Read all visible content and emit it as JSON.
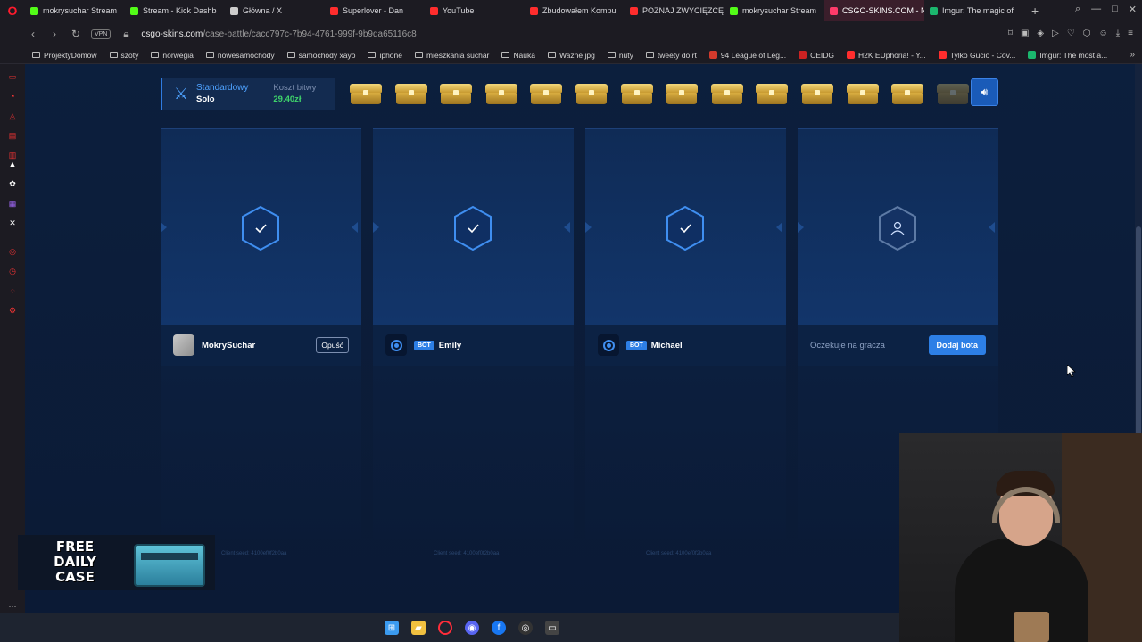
{
  "browser": {
    "tabs": [
      {
        "label": "mokrysuchar Stream",
        "color": "#53fc18"
      },
      {
        "label": "Stream - Kick Dashb",
        "color": "#53fc18"
      },
      {
        "label": "Główna / X",
        "color": "#cccccc"
      },
      {
        "label": "Superlover - Dan",
        "color": "#ff2d2d"
      },
      {
        "label": "YouTube",
        "color": "#ff2d2d"
      },
      {
        "label": "Zbudowałem Kompu",
        "color": "#ff2d2d"
      },
      {
        "label": "POZNAJ ZWYCIĘZCĘ",
        "color": "#ff2d2d"
      },
      {
        "label": "mokrysuchar Stream",
        "color": "#53fc18"
      },
      {
        "label": "CSGO-SKINS.COM - Naj",
        "color": "#ff3b6a",
        "active": true
      },
      {
        "label": "Imgur: The magic of",
        "color": "#1bb76e"
      }
    ],
    "url_domain": "csgo-skins.com",
    "url_path": "/case-battle/cacc797c-7b94-4761-999f-9b9da65116c8",
    "vpn_label": "VPN",
    "bookmarks": [
      {
        "label": "ProjektyDomow",
        "type": "folder"
      },
      {
        "label": "szoty",
        "type": "folder"
      },
      {
        "label": "norwegia",
        "type": "folder"
      },
      {
        "label": "nowesamochody",
        "type": "folder"
      },
      {
        "label": "samochody xayo",
        "type": "folder"
      },
      {
        "label": "iphone",
        "type": "folder"
      },
      {
        "label": "mieszkania suchar",
        "type": "folder"
      },
      {
        "label": "Nauka",
        "type": "folder"
      },
      {
        "label": "Ważne jpg",
        "type": "folder"
      },
      {
        "label": "nuty",
        "type": "folder"
      },
      {
        "label": "tweety do rt",
        "type": "folder"
      },
      {
        "label": "94 League of Leg...",
        "type": "site",
        "color": "#d33a2c"
      },
      {
        "label": "CEIDG",
        "type": "site",
        "color": "#cc2222"
      },
      {
        "label": "H2K EUphoria! - Y...",
        "type": "site",
        "color": "#ff2d2d"
      },
      {
        "label": "Tylko Gucio - Cov...",
        "type": "site",
        "color": "#ff2d2d"
      },
      {
        "label": "Imgur: The most a...",
        "type": "site",
        "color": "#1bb76e"
      }
    ]
  },
  "battle": {
    "mode_label": "Standardowy",
    "mode_sub": "Solo",
    "cost_label": "Koszt bitwy",
    "cost_value": "29.40zł",
    "case_count": 14,
    "players": [
      {
        "name": "MokrySuchar",
        "bot": false,
        "ready": true,
        "action": "Opuść",
        "seed": "Client seed: 4100ef0f2b0aa"
      },
      {
        "name": "Emily",
        "bot": true,
        "bot_label": "BOT",
        "ready": true,
        "seed": "Client seed: 4100ef0f2b0aa"
      },
      {
        "name": "Michael",
        "bot": true,
        "bot_label": "BOT",
        "ready": true,
        "seed": "Client seed: 4100ef0f2b0aa"
      },
      {
        "waiting_label": "Oczekuje na gracza",
        "action": "Dodaj bota",
        "empty": true
      }
    ]
  },
  "promo": {
    "line1": "FREE",
    "line2": "DAILY",
    "line3": "CASE"
  },
  "colors": {
    "accent": "#2d7fe6",
    "cost": "#3fd46b",
    "bg": "#0b1a33"
  }
}
